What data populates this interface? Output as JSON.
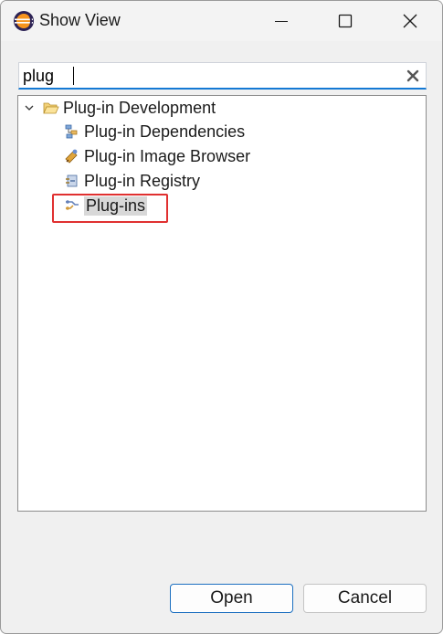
{
  "window": {
    "title": "Show View"
  },
  "search": {
    "value": "plug"
  },
  "tree": {
    "category": {
      "label": "Plug-in Development",
      "expanded": true
    },
    "items": [
      {
        "label": "Plug-in Dependencies",
        "icon": "dependencies-view-icon"
      },
      {
        "label": "Plug-in Image Browser",
        "icon": "image-browser-view-icon"
      },
      {
        "label": "Plug-in Registry",
        "icon": "registry-view-icon"
      },
      {
        "label": "Plug-ins",
        "icon": "plugins-view-icon",
        "selected": true
      }
    ]
  },
  "buttons": {
    "open": "Open",
    "cancel": "Cancel"
  },
  "colors": {
    "accent": "#1479d4",
    "highlight_box": "#e03030",
    "selection": "#d8d8d8"
  }
}
